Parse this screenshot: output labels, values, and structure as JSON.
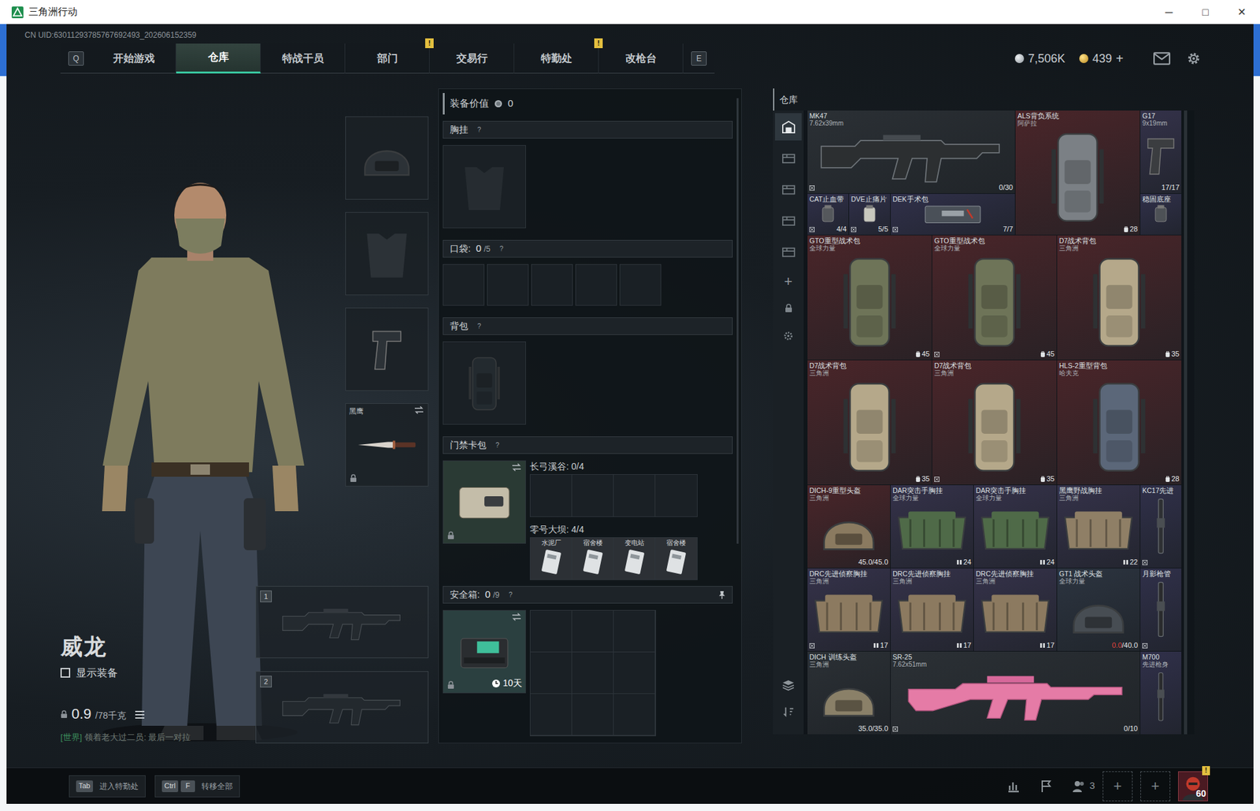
{
  "window": {
    "title": "三角洲行动",
    "controls": [
      "─",
      "□",
      "✕"
    ]
  },
  "uid": "CN UID:63011293785767692493_202606152359",
  "nav": {
    "key_left": "Q",
    "key_right": "E",
    "tabs": [
      {
        "label": "开始游戏",
        "selected": false
      },
      {
        "label": "仓库",
        "selected": true
      },
      {
        "label": "特战干员",
        "selected": false
      },
      {
        "label": "部门",
        "selected": false,
        "badge": "!"
      },
      {
        "label": "交易行",
        "selected": false
      },
      {
        "label": "特勤处",
        "selected": false,
        "badge": "!"
      },
      {
        "label": "改枪台",
        "selected": false
      }
    ]
  },
  "currency": [
    {
      "kind": "silver",
      "value": "7,506K"
    },
    {
      "kind": "gold",
      "value": "439",
      "add": "+"
    }
  ],
  "character": {
    "name": "威龙",
    "show_equipment": {
      "label": "显示装备",
      "checked": false
    },
    "weight": {
      "value": "0.9",
      "max": "/78千克"
    },
    "chat": {
      "channel": "[世界]",
      "text": "领着老大过二员: 最后一对拉"
    }
  },
  "slots": [
    {
      "kind": "helmet"
    },
    {
      "kind": "armor"
    },
    {
      "kind": "pistol"
    },
    {
      "kind": "melee",
      "label": "黑鹰",
      "locked": true
    }
  ],
  "weapons": [
    {
      "number": "1"
    },
    {
      "number": "2"
    }
  ],
  "loadout": {
    "value_label": "装备价值",
    "value": "0",
    "chest": {
      "title": "胸挂",
      "help": "?"
    },
    "pockets": {
      "title": "口袋:",
      "count": "0",
      "capacity": "/5",
      "help": "?",
      "slot_count": 5
    },
    "backpack": {
      "title": "背包",
      "help": "?"
    },
    "keycase": {
      "title": "门禁卡包",
      "help": "?",
      "locked": true,
      "maps": [
        {
          "label": "长弓溪谷: 0/4",
          "slot_count": 4,
          "cards": []
        },
        {
          "label": "零号大坝: 4/4",
          "slot_count": 4,
          "cards": [
            "水泥厂",
            "宿舍楼",
            "变电站",
            "宿舍楼"
          ]
        }
      ]
    },
    "safebox": {
      "title": "安全箱:",
      "count": "0",
      "capacity": "/9",
      "help": "?",
      "timer": "10天",
      "locked": true,
      "slot_count": 9
    }
  },
  "warehouse": {
    "title": "仓库",
    "tabs": [
      {
        "selected": true
      },
      {
        "selected": false
      },
      {
        "selected": false
      },
      {
        "selected": false
      },
      {
        "selected": false
      }
    ],
    "add": "+",
    "items": [
      {
        "name": "MK47",
        "sub": "7.62x39mm",
        "kind": "rifle",
        "color": "#2b3035",
        "skin": "#2c2f31",
        "reading": "0/30",
        "bound": true
      },
      {
        "name": "ALS背负系统",
        "sub": "阿萨拉",
        "kind": "backpack",
        "color": "#4a2529",
        "skin": "#7b8085",
        "reading": "28",
        "bound": false
      },
      {
        "name": "G17",
        "sub": "9x19mm",
        "kind": "pistol",
        "color": "#34324a",
        "skin": "#3b3d40",
        "reading": "17/17",
        "bound": false
      },
      {
        "name": "CAT止血带",
        "sub": "",
        "kind": "small",
        "color": "#30304a",
        "skin": "#55585c",
        "reading": "4/4",
        "bound": true
      },
      {
        "name": "DVE止痛片",
        "sub": "",
        "kind": "small",
        "color": "#30304a",
        "skin": "#c8c8be",
        "reading": "5/5",
        "bound": true
      },
      {
        "name": "DEK手术包",
        "sub": "",
        "kind": "kit",
        "color": "#30304a",
        "skin": "#4a5058",
        "reading": "7/7",
        "bound": true
      },
      {
        "name": "稳固底座",
        "sub": "",
        "kind": "small",
        "color": "#30304a",
        "skin": "#4d5156",
        "reading": "",
        "bound": false
      },
      {
        "name": "GTO重型战术包",
        "sub": "全球力量",
        "kind": "backpack",
        "color": "#4a2529",
        "skin": "#6e7458",
        "reading": "45",
        "bound": false
      },
      {
        "name": "GTO重型战术包",
        "sub": "全球力量",
        "kind": "backpack",
        "color": "#4a2529",
        "skin": "#6e7458",
        "reading": "45",
        "bound": true
      },
      {
        "name": "D7战术背包",
        "sub": "三角洲",
        "kind": "backpack",
        "color": "#4a2529",
        "skin": "#b5a88a",
        "reading": "35",
        "bound": false
      },
      {
        "name": "D7战术背包",
        "sub": "三角洲",
        "kind": "backpack",
        "color": "#4a2529",
        "skin": "#b5a88a",
        "reading": "35",
        "bound": false
      },
      {
        "name": "D7战术背包",
        "sub": "三角洲",
        "kind": "backpack",
        "color": "#4a2529",
        "skin": "#b5a88a",
        "reading": "35",
        "bound": true
      },
      {
        "name": "HLS-2重型背包",
        "sub": "哈夫克",
        "kind": "backpack",
        "color": "#4a2529",
        "skin": "#5b6779",
        "reading": "28",
        "bound": false
      },
      {
        "name": "DICH-9重型头盔",
        "sub": "三角洲",
        "kind": "helmet",
        "color": "#4a2529",
        "skin": "#8a7a60",
        "reading": "45.0/45.0",
        "bound": false
      },
      {
        "name": "DAR突击手胸挂",
        "sub": "全球力量",
        "kind": "rig",
        "color": "#35324a",
        "skin": "#4f6a48",
        "reading": "24",
        "bound": false
      },
      {
        "name": "DAR突击手胸挂",
        "sub": "全球力量",
        "kind": "rig",
        "color": "#35324a",
        "skin": "#4f6a48",
        "reading": "24",
        "bound": false
      },
      {
        "name": "黑鹰野战胸挂",
        "sub": "三角洲",
        "kind": "rig",
        "color": "#35324a",
        "skin": "#8f7f66",
        "reading": "22",
        "bound": false
      },
      {
        "name": "KC17先进",
        "sub": "",
        "kind": "part",
        "color": "#30304a",
        "skin": "#2e3033",
        "reading": "",
        "bound": true
      },
      {
        "name": "DRC先进侦察胸挂",
        "sub": "三角洲",
        "kind": "rig",
        "color": "#35324a",
        "skin": "#8c7a60",
        "reading": "17",
        "bound": true
      },
      {
        "name": "DRC先进侦察胸挂",
        "sub": "三角洲",
        "kind": "rig",
        "color": "#35324a",
        "skin": "#8c7a60",
        "reading": "17",
        "bound": false
      },
      {
        "name": "DRC先进侦察胸挂",
        "sub": "三角洲",
        "kind": "rig",
        "color": "#35324a",
        "skin": "#8c7a60",
        "reading": "17",
        "bound": false
      },
      {
        "name": "GT1 战术头盔",
        "sub": "全球力量",
        "kind": "helmet",
        "color": "#2c3440",
        "skin": "#474d53",
        "reading_red": "0.0",
        "reading": "/40.0",
        "bound": false
      },
      {
        "name": "月影枪管",
        "sub": "",
        "kind": "part",
        "color": "#30304a",
        "skin": "#2a2b2d",
        "reading": "",
        "bound": true
      },
      {
        "name": "DICH 训练头盔",
        "sub": "三角洲",
        "kind": "helmet",
        "color": "#2b3035",
        "skin": "#8a8068",
        "reading": "35.0/35.0",
        "bound": false
      },
      {
        "name": "SR-25",
        "sub": "7.62x51mm",
        "kind": "sniper",
        "color": "#2b3035",
        "skin": "#e57ba6",
        "reading": "0/10",
        "bound": true
      },
      {
        "name": "M700",
        "sub": "先进枪身",
        "kind": "part",
        "color": "#30304a",
        "skin": "#2a2b2d",
        "reading": "",
        "bound": false
      }
    ]
  },
  "bottom_bar": {
    "hints": [
      {
        "keys": [
          "Tab"
        ],
        "label": "进入特勤处"
      },
      {
        "keys": [
          "Ctrl",
          "F"
        ],
        "label": "转移全部"
      }
    ],
    "friends": "3",
    "slots": [
      "+",
      "+"
    ],
    "level": "60",
    "level_alert": "!"
  }
}
